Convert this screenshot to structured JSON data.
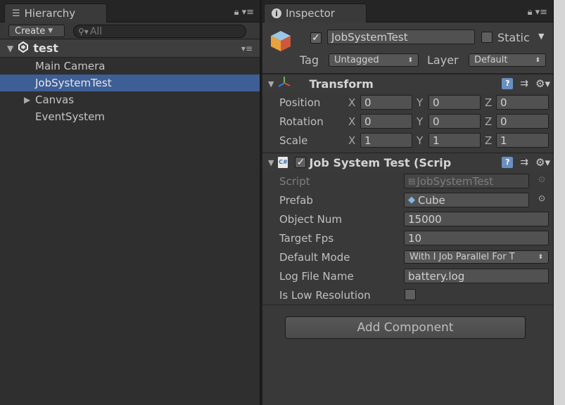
{
  "hierarchy": {
    "tab_label": "Hierarchy",
    "create_label": "Create",
    "search_placeholder": "All",
    "scene_name": "test",
    "items": [
      {
        "label": "Main Camera",
        "selected": false,
        "foldout": false
      },
      {
        "label": "JobSystemTest",
        "selected": true,
        "foldout": false
      },
      {
        "label": "Canvas",
        "selected": false,
        "foldout": true
      },
      {
        "label": "EventSystem",
        "selected": false,
        "foldout": false
      }
    ]
  },
  "inspector": {
    "tab_label": "Inspector",
    "object_name": "JobSystemTest",
    "active": true,
    "static_label": "Static",
    "static_checked": false,
    "tag_label": "Tag",
    "tag_value": "Untagged",
    "layer_label": "Layer",
    "layer_value": "Default",
    "transform": {
      "title": "Transform",
      "position_label": "Position",
      "rotation_label": "Rotation",
      "scale_label": "Scale",
      "position": {
        "x": "0",
        "y": "0",
        "z": "0"
      },
      "rotation": {
        "x": "0",
        "y": "0",
        "z": "0"
      },
      "scale": {
        "x": "1",
        "y": "1",
        "z": "1"
      },
      "axis_x": "X",
      "axis_y": "Y",
      "axis_z": "Z"
    },
    "script_component": {
      "title": "Job System Test (Scrip",
      "enabled": true,
      "script_label": "Script",
      "script_value": "JobSystemTest",
      "prefab_label": "Prefab",
      "prefab_value": "Cube",
      "object_num_label": "Object Num",
      "object_num_value": "15000",
      "target_fps_label": "Target Fps",
      "target_fps_value": "10",
      "default_mode_label": "Default Mode",
      "default_mode_value": "With I Job Parallel For T",
      "log_file_label": "Log File Name",
      "log_file_value": "battery.log",
      "low_res_label": "Is Low Resolution",
      "low_res_checked": false
    },
    "add_component_label": "Add Component"
  },
  "colors": {
    "selection": "#3e5f96",
    "panel_bg": "#393939",
    "field_bg": "#515151"
  }
}
